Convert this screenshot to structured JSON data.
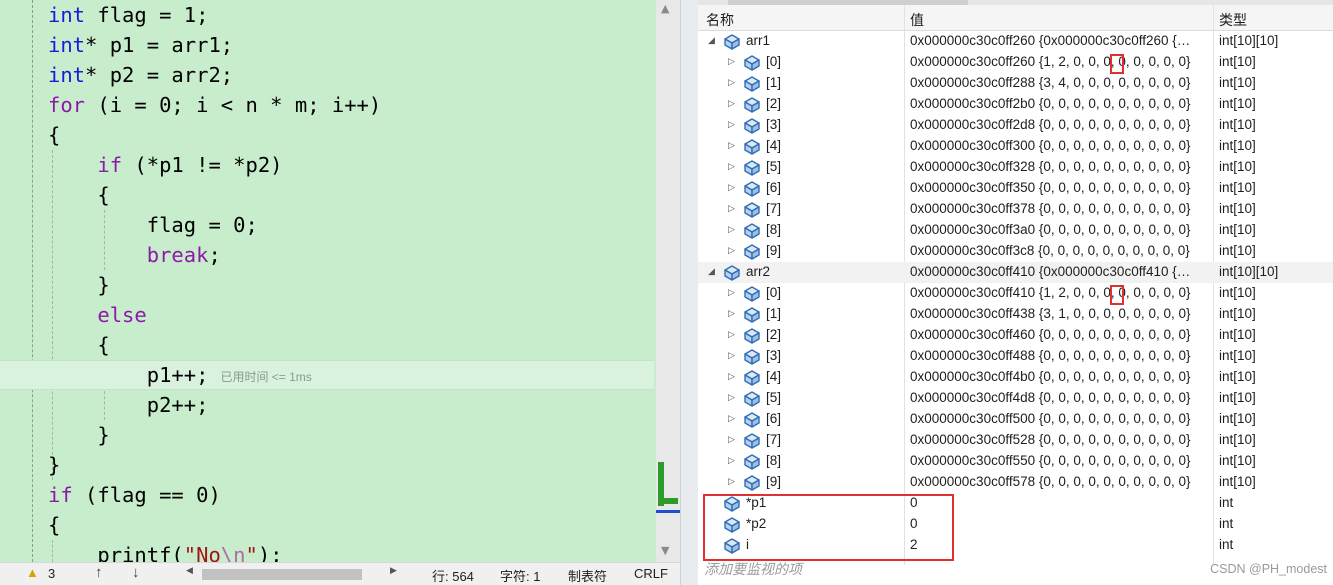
{
  "editor": {
    "lines": [
      {
        "segs": [
          {
            "c": "kw",
            "t": "int"
          },
          {
            "t": " flag = 1;"
          }
        ]
      },
      {
        "segs": [
          {
            "c": "kw",
            "t": "int"
          },
          {
            "t": "* p1 = arr1;"
          }
        ]
      },
      {
        "segs": [
          {
            "c": "kw",
            "t": "int"
          },
          {
            "t": "* p2 = arr2;"
          }
        ]
      },
      {
        "segs": [
          {
            "c": "kc",
            "t": "for"
          },
          {
            "t": " (i = 0; i < n * m; i++)"
          }
        ]
      },
      {
        "segs": [
          {
            "t": "{"
          }
        ]
      },
      {
        "segs": [
          {
            "t": "    "
          },
          {
            "c": "kc",
            "t": "if"
          },
          {
            "t": " (*p1 != *p2)"
          }
        ]
      },
      {
        "segs": [
          {
            "t": "    {"
          }
        ]
      },
      {
        "segs": [
          {
            "t": "        flag = 0;"
          }
        ]
      },
      {
        "segs": [
          {
            "t": "        "
          },
          {
            "c": "kc",
            "t": "break"
          },
          {
            "t": ";"
          }
        ]
      },
      {
        "segs": [
          {
            "t": "    }"
          }
        ]
      },
      {
        "segs": [
          {
            "t": "    "
          },
          {
            "c": "kc",
            "t": "else"
          }
        ]
      },
      {
        "segs": [
          {
            "t": "    {"
          }
        ]
      },
      {
        "segs": [
          {
            "t": "        p1++;"
          },
          {
            "c": "ann",
            "t": "已用时间 <= 1ms"
          }
        ]
      },
      {
        "segs": [
          {
            "t": "        p2++;"
          }
        ]
      },
      {
        "segs": [
          {
            "t": "    }"
          }
        ]
      },
      {
        "segs": [
          {
            "t": "}"
          }
        ]
      },
      {
        "segs": [
          {
            "c": "kc",
            "t": "if"
          },
          {
            "t": " (flag == 0)"
          }
        ]
      },
      {
        "segs": [
          {
            "t": "{"
          }
        ]
      },
      {
        "segs": [
          {
            "t": "    printf("
          },
          {
            "c": "str",
            "t": "\"No"
          },
          {
            "c": "esc",
            "t": "\\n"
          },
          {
            "c": "str",
            "t": "\""
          },
          {
            "t": ");"
          }
        ]
      }
    ]
  },
  "status_bar": {
    "warnings": "3",
    "line": "行: 564",
    "char": "字符: 1",
    "tabs": "制表符",
    "eol": "CRLF"
  },
  "watch": {
    "headers": {
      "name": "名称",
      "value": "值",
      "type": "类型"
    },
    "rows": [
      {
        "level": 0,
        "expander": "expanded",
        "name": "arr1",
        "value": "0x000000c30c0ff260 {0x000000c30c0ff260 {…",
        "type": "int[10][10]",
        "shaded": false
      },
      {
        "level": 1,
        "expander": "collapsed",
        "name": "[0]",
        "value": "0x000000c30c0ff260 {1, 2, 0, 0, 0, 0, 0, 0, 0, 0}",
        "type": "int[10]"
      },
      {
        "level": 1,
        "expander": "collapsed",
        "name": "[1]",
        "value": "0x000000c30c0ff288 {3, 4, 0, 0, 0, 0, 0, 0, 0, 0}",
        "type": "int[10]"
      },
      {
        "level": 1,
        "expander": "collapsed",
        "name": "[2]",
        "value": "0x000000c30c0ff2b0 {0, 0, 0, 0, 0, 0, 0, 0, 0, 0}",
        "type": "int[10]"
      },
      {
        "level": 1,
        "expander": "collapsed",
        "name": "[3]",
        "value": "0x000000c30c0ff2d8 {0, 0, 0, 0, 0, 0, 0, 0, 0, 0}",
        "type": "int[10]"
      },
      {
        "level": 1,
        "expander": "collapsed",
        "name": "[4]",
        "value": "0x000000c30c0ff300 {0, 0, 0, 0, 0, 0, 0, 0, 0, 0}",
        "type": "int[10]"
      },
      {
        "level": 1,
        "expander": "collapsed",
        "name": "[5]",
        "value": "0x000000c30c0ff328 {0, 0, 0, 0, 0, 0, 0, 0, 0, 0}",
        "type": "int[10]"
      },
      {
        "level": 1,
        "expander": "collapsed",
        "name": "[6]",
        "value": "0x000000c30c0ff350 {0, 0, 0, 0, 0, 0, 0, 0, 0, 0}",
        "type": "int[10]"
      },
      {
        "level": 1,
        "expander": "collapsed",
        "name": "[7]",
        "value": "0x000000c30c0ff378 {0, 0, 0, 0, 0, 0, 0, 0, 0, 0}",
        "type": "int[10]"
      },
      {
        "level": 1,
        "expander": "collapsed",
        "name": "[8]",
        "value": "0x000000c30c0ff3a0 {0, 0, 0, 0, 0, 0, 0, 0, 0, 0}",
        "type": "int[10]"
      },
      {
        "level": 1,
        "expander": "collapsed",
        "name": "[9]",
        "value": "0x000000c30c0ff3c8 {0, 0, 0, 0, 0, 0, 0, 0, 0, 0}",
        "type": "int[10]"
      },
      {
        "level": 0,
        "expander": "expanded",
        "name": "arr2",
        "value": "0x000000c30c0ff410 {0x000000c30c0ff410 {…",
        "type": "int[10][10]",
        "shaded": true
      },
      {
        "level": 1,
        "expander": "collapsed",
        "name": "[0]",
        "value": "0x000000c30c0ff410 {1, 2, 0, 0, 0, 0, 0, 0, 0, 0}",
        "type": "int[10]"
      },
      {
        "level": 1,
        "expander": "collapsed",
        "name": "[1]",
        "value": "0x000000c30c0ff438 {3, 1, 0, 0, 0, 0, 0, 0, 0, 0}",
        "type": "int[10]"
      },
      {
        "level": 1,
        "expander": "collapsed",
        "name": "[2]",
        "value": "0x000000c30c0ff460 {0, 0, 0, 0, 0, 0, 0, 0, 0, 0}",
        "type": "int[10]"
      },
      {
        "level": 1,
        "expander": "collapsed",
        "name": "[3]",
        "value": "0x000000c30c0ff488 {0, 0, 0, 0, 0, 0, 0, 0, 0, 0}",
        "type": "int[10]"
      },
      {
        "level": 1,
        "expander": "collapsed",
        "name": "[4]",
        "value": "0x000000c30c0ff4b0 {0, 0, 0, 0, 0, 0, 0, 0, 0, 0}",
        "type": "int[10]"
      },
      {
        "level": 1,
        "expander": "collapsed",
        "name": "[5]",
        "value": "0x000000c30c0ff4d8 {0, 0, 0, 0, 0, 0, 0, 0, 0, 0}",
        "type": "int[10]"
      },
      {
        "level": 1,
        "expander": "collapsed",
        "name": "[6]",
        "value": "0x000000c30c0ff500 {0, 0, 0, 0, 0, 0, 0, 0, 0, 0}",
        "type": "int[10]"
      },
      {
        "level": 1,
        "expander": "collapsed",
        "name": "[7]",
        "value": "0x000000c30c0ff528 {0, 0, 0, 0, 0, 0, 0, 0, 0, 0}",
        "type": "int[10]"
      },
      {
        "level": 1,
        "expander": "collapsed",
        "name": "[8]",
        "value": "0x000000c30c0ff550 {0, 0, 0, 0, 0, 0, 0, 0, 0, 0}",
        "type": "int[10]"
      },
      {
        "level": 1,
        "expander": "collapsed",
        "name": "[9]",
        "value": "0x000000c30c0ff578 {0, 0, 0, 0, 0, 0, 0, 0, 0, 0}",
        "type": "int[10]"
      },
      {
        "level": 0,
        "expander": "none",
        "name": "*p1",
        "value": "0",
        "type": "int"
      },
      {
        "level": 0,
        "expander": "none",
        "name": "*p2",
        "value": "0",
        "type": "int"
      },
      {
        "level": 0,
        "expander": "none",
        "name": "i",
        "value": "2",
        "type": "int"
      }
    ],
    "add_placeholder": "添加要监视的项",
    "watermark": "CSDN @PH_modest"
  },
  "colors": {
    "editor_bg": "#c7edcc",
    "keyword_blue": "#1a1adc",
    "keyword_purple": "#8c1aa6",
    "string_red": "#a31515",
    "highlight_red": "#e03131"
  }
}
